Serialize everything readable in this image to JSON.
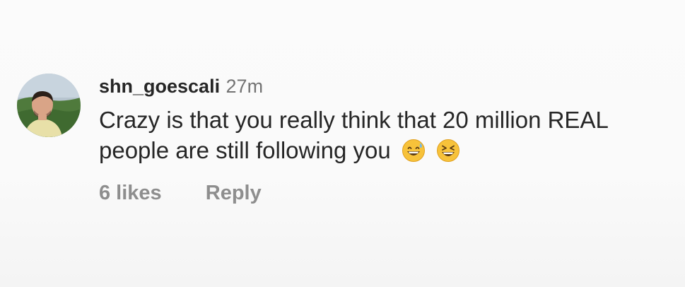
{
  "comment": {
    "username": "shn_goescali",
    "time": "27m",
    "text": "Crazy is that you really think that 20 million REAL people are still following you",
    "emojis": [
      "grinning-face-with-sweat-emoji",
      "grinning-squinting-face-emoji"
    ],
    "likes": "6 likes",
    "reply_label": "Reply"
  },
  "colors": {
    "background": "#fafafa",
    "text": "#262626",
    "secondary": "#8e8e8e"
  }
}
